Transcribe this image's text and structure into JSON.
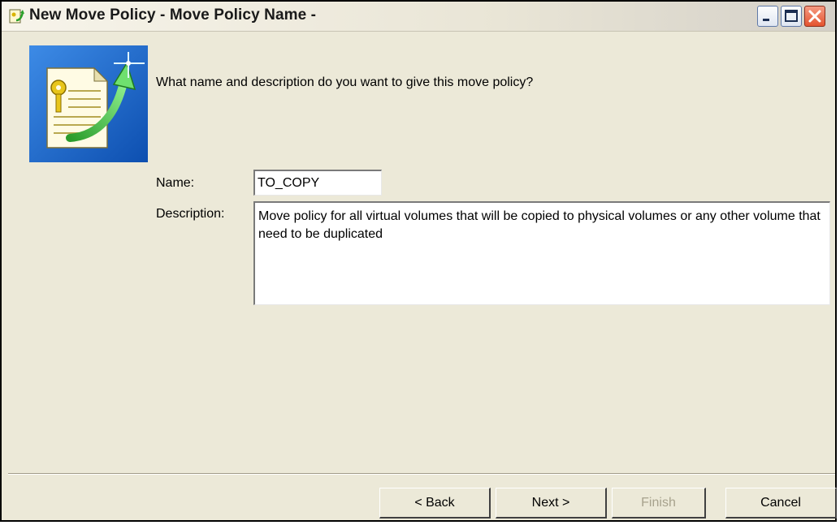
{
  "window": {
    "title": "New Move Policy - Move Policy Name -",
    "app_icon": "policy-app-icon",
    "controls": [
      "minimize-icon",
      "maximize-icon",
      "close-icon"
    ]
  },
  "wizard": {
    "image": "policy-document-key-arrow-icon",
    "question": "What name and description do you want to give this move policy?"
  },
  "form": {
    "name_label": "Name:",
    "name_value": "TO_COPY",
    "description_label": "Description:",
    "description_value": "Move policy for all virtual volumes that will be copied to physical volumes or any other volume that need to be duplicated"
  },
  "buttons": {
    "back": "< Back",
    "next": "Next >",
    "finish": "Finish",
    "cancel": "Cancel"
  },
  "colors": {
    "dialog_background": "#ece9d8",
    "image_background": "#1f6fd0",
    "close_button": "#e4532f",
    "disabled_text": "#a7a28d"
  }
}
